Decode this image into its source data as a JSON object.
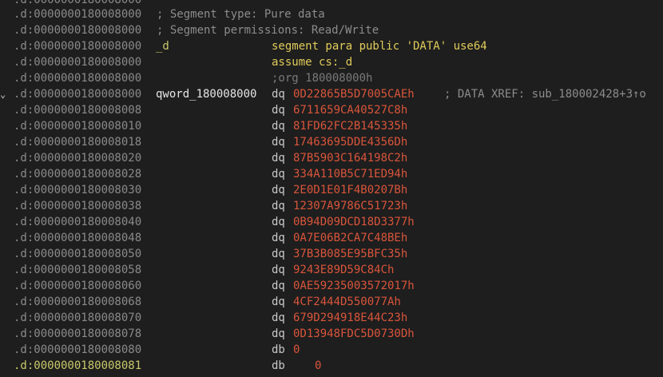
{
  "colors": {
    "background": "#1e1e1e",
    "address": "#8a8a8a",
    "address_highlight": "#c8c86a",
    "segment_label": "#c8c86a",
    "directive": "#e0cc5a",
    "operand_number": "#d9553b",
    "comment": "#8c8c8c"
  },
  "rows": [
    {
      "addr": ".d:0000000180008000",
      "comment": "; Segment type: Pure data"
    },
    {
      "addr": ".d:0000000180008000",
      "comment": "; Segment permissions: Read/Write"
    },
    {
      "addr": ".d:0000000180008000",
      "label": "_d",
      "directive": "segment para public 'DATA' use64"
    },
    {
      "addr": ".d:0000000180008000",
      "directive": "assume cs:_d"
    },
    {
      "addr": ".d:0000000180008000",
      "org": ";org 180008000h"
    },
    {
      "addr": ".d:0000000180008000",
      "label": "qword_180008000",
      "mnemonic": "dq",
      "operand": "0D22865B5D7005CAEh",
      "xref": "; DATA XREF: sub_180002428+3↑o",
      "arrow": "⌄"
    },
    {
      "addr": ".d:0000000180008008",
      "mnemonic": "dq",
      "operand": "6711659CA40527C8h"
    },
    {
      "addr": ".d:0000000180008010",
      "mnemonic": "dq",
      "operand": "81FD62FC2B145335h"
    },
    {
      "addr": ".d:0000000180008018",
      "mnemonic": "dq",
      "operand": "17463695DDE4356Dh"
    },
    {
      "addr": ".d:0000000180008020",
      "mnemonic": "dq",
      "operand": "87B5903C164198C2h"
    },
    {
      "addr": ".d:0000000180008028",
      "mnemonic": "dq",
      "operand": "334A110B5C71ED94h"
    },
    {
      "addr": ".d:0000000180008030",
      "mnemonic": "dq",
      "operand": "2E0D1E01F4B0207Bh"
    },
    {
      "addr": ".d:0000000180008038",
      "mnemonic": "dq",
      "operand": "12307A9786C51723h"
    },
    {
      "addr": ".d:0000000180008040",
      "mnemonic": "dq",
      "operand": "0B94D09DCD18D3377h"
    },
    {
      "addr": ".d:0000000180008048",
      "mnemonic": "dq",
      "operand": "0A7E06B2CA7C48BEh"
    },
    {
      "addr": ".d:0000000180008050",
      "mnemonic": "dq",
      "operand": "37B3B085E95BFC35h"
    },
    {
      "addr": ".d:0000000180008058",
      "mnemonic": "dq",
      "operand": "9243E89D59C84Ch"
    },
    {
      "addr": ".d:0000000180008060",
      "mnemonic": "dq",
      "operand": "0AE59235003572017h"
    },
    {
      "addr": ".d:0000000180008068",
      "mnemonic": "dq",
      "operand": "4CF2444D550077Ah"
    },
    {
      "addr": ".d:0000000180008070",
      "mnemonic": "dq",
      "operand": "679D294918E44C23h"
    },
    {
      "addr": ".d:0000000180008078",
      "mnemonic": "dq",
      "operand": "0D13948FDC5D0730Dh"
    },
    {
      "addr": ".d:0000000180008080",
      "mnemonic": "db",
      "operand": "0"
    },
    {
      "addr": ".d:0000000180008081",
      "mnemonic": "db",
      "operand": "0",
      "highlight": true,
      "indent": true
    }
  ]
}
